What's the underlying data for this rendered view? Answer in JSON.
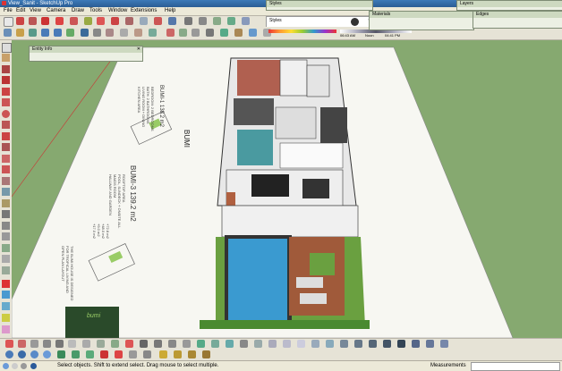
{
  "window": {
    "title": "View_Sanit - SketchUp Pro"
  },
  "menu": [
    "File",
    "Edit",
    "View",
    "Camera",
    "Draw",
    "Tools",
    "Window",
    "Extensions",
    "Help"
  ],
  "panels": {
    "styles": "Styles",
    "materials": "Materials",
    "layers": "Layers",
    "edges": "Edges",
    "entity_info": "Entity Info"
  },
  "shadow_bar": {
    "time_left": "06:43 AM",
    "noon": "Noon",
    "time_right": "04:41 PM"
  },
  "sheet": {
    "title": "BUMI",
    "block1_title": "BUMI-1 138.2 m2",
    "block1_text": [
      "BEDROOM: 2 BEDROOMS",
      "BATH: 2 BATHROOMS",
      "LIVING ROOM + DINING",
      "KITCHEN AREA"
    ],
    "block2_title": "BUMI-3 139.2 m2",
    "block2_text": [
      "ROOFTOP AREA",
      "POOL, SUNDECK + ONSITE ALL",
      "MAIDS ROOM",
      "HALLWAY AND GARDEN"
    ],
    "block2_values": [
      "+72.8 m2",
      "+48.0 m2",
      "+9.0 m2",
      "+17.0 m2"
    ],
    "bottom_text": [
      "THE BUMI HOUSE IS DESIGNED",
      "FOR TROPICAL LIVING AND",
      "OPEN PLAN LAYOUT"
    ],
    "logo_text": "bumi"
  },
  "status": {
    "hint": "Select objects. Shift to extend select. Drag mouse to select multiple.",
    "measurements_label": "Measurements"
  },
  "colors": {
    "accent": "#3d7ab8",
    "grass": "#86a970",
    "pool": "#3a9ad0",
    "deck": "#a05a3a"
  }
}
